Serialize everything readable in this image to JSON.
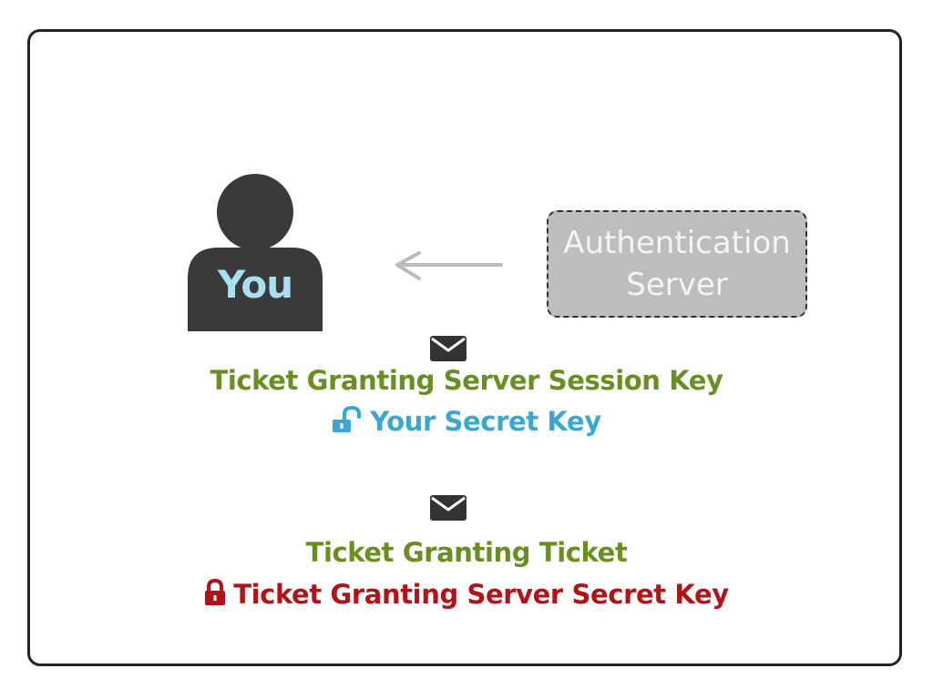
{
  "colors": {
    "green": "#6b8e23",
    "blue": "#3aa7d2",
    "red": "#b01419",
    "person": "#3a3a3a",
    "you_text": "#a9e0ef",
    "box_fill": "#bdbdbd",
    "arrow": "#bbbbbb",
    "envelope": "#333333"
  },
  "person": {
    "label": "You",
    "icon": "person-silhouette-icon"
  },
  "auth_server": {
    "line1": "Authentication",
    "line2": "Server"
  },
  "arrow": {
    "icon": "arrow-left-icon"
  },
  "message1": {
    "envelope_icon": "envelope-icon",
    "title": "Ticket Granting Server Session Key",
    "lock_icon": "lock-open-icon",
    "key": "Your Secret Key"
  },
  "message2": {
    "envelope_icon": "envelope-icon",
    "title": "Ticket Granting Ticket",
    "lock_icon": "lock-closed-icon",
    "key": "Ticket Granting Server Secret Key"
  }
}
